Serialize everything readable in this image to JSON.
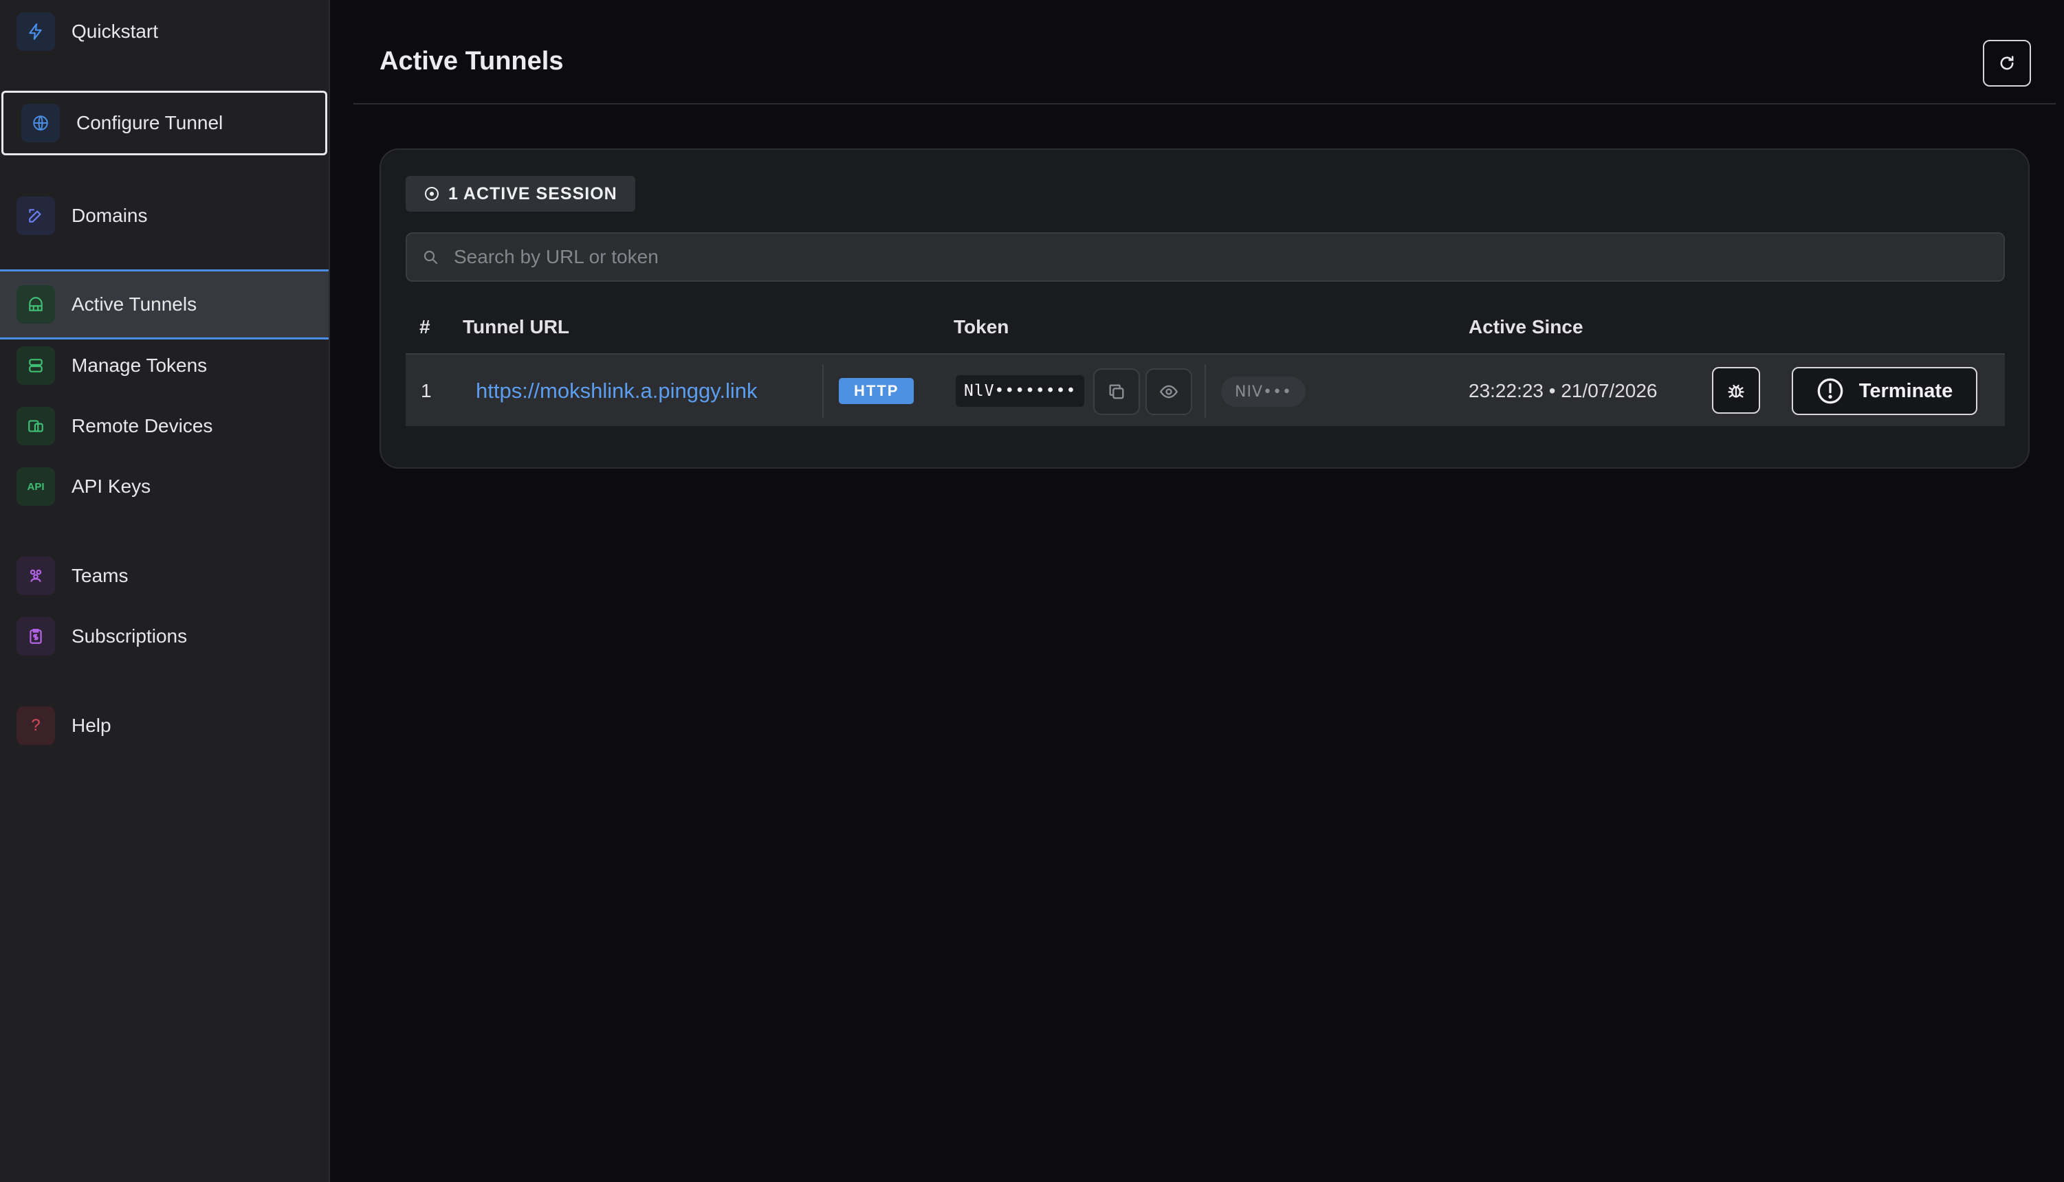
{
  "sidebar": {
    "items": [
      {
        "label": "Quickstart",
        "icon": "bolt-icon",
        "color": "#4c8ee6"
      },
      {
        "label": "Configure Tunnel",
        "icon": "www-globe-icon",
        "color": "#4c8ee6"
      },
      {
        "label": "Domains",
        "icon": "edit-pen-icon",
        "color": "#6d7ef0"
      },
      {
        "label": "Active Tunnels",
        "icon": "tunnel-icon",
        "color": "#3fbf74"
      },
      {
        "label": "Manage Tokens",
        "icon": "server-icon",
        "color": "#3fbf74"
      },
      {
        "label": "Remote Devices",
        "icon": "devices-icon",
        "color": "#3fbf74"
      },
      {
        "label": "API Keys",
        "icon": "api-icon",
        "icon_text": "API",
        "color": "#3fbf74"
      },
      {
        "label": "Teams",
        "icon": "people-icon",
        "color": "#b565e8"
      },
      {
        "label": "Subscriptions",
        "icon": "clipboard-dollar-icon",
        "color": "#b565e8"
      },
      {
        "label": "Help",
        "icon": "question-icon",
        "icon_text": "?",
        "color": "#d84a5a"
      }
    ]
  },
  "header": {
    "title": "Active Tunnels",
    "refresh_icon": "refresh-icon"
  },
  "sessions": {
    "badge": "1 ACTIVE SESSION",
    "search_placeholder": "Search by URL or token"
  },
  "table": {
    "columns": [
      "#",
      "Tunnel URL",
      "Token",
      "Active Since"
    ],
    "rows": [
      {
        "index": "1",
        "url": "https://mokshlink.a.pinggy.link",
        "protocol": "HTTP",
        "token_masked": "NlV••••••••",
        "token_prefix": "NIV•••",
        "active_since": "23:22:23 • 21/07/2026",
        "terminate_label": "Terminate"
      }
    ]
  },
  "colors": {
    "accent": "#4c8ee6",
    "link": "#5c9ef0",
    "background": "#0c0c0e",
    "sidebar": "#202023"
  }
}
